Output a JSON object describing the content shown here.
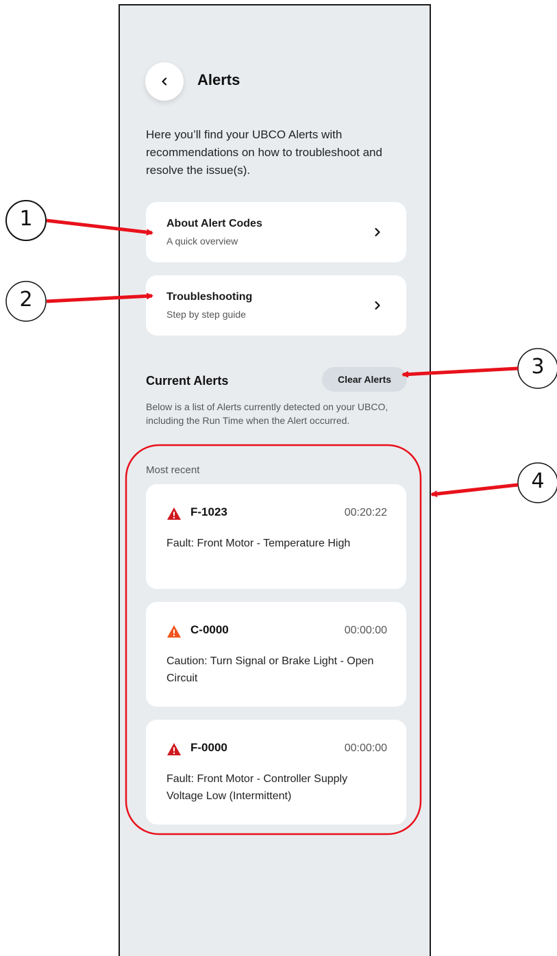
{
  "header": {
    "title": "Alerts"
  },
  "intro": "Here you’ll find your UBCO Alerts with recommendations on how to troubleshoot and resolve the issue(s).",
  "nav_cards": [
    {
      "title": "About Alert Codes",
      "subtitle": "A quick overview"
    },
    {
      "title": "Troubleshooting",
      "subtitle": "Step by step guide"
    }
  ],
  "current": {
    "title": "Current Alerts",
    "clear_label": "Clear Alerts",
    "description": "Below is a list of Alerts currently detected on your UBCO, including the Run Time when the Alert occurred.",
    "recent_label": "Most recent"
  },
  "alerts": [
    {
      "code": "F-1023",
      "time": "00:20:22",
      "description": "Fault: Front Motor - Temperature High",
      "severity": "fault",
      "icon_color": "#d0191f"
    },
    {
      "code": "C-0000",
      "time": "00:00:00",
      "description": "Caution: Turn Signal or Brake Light - Open Circuit",
      "severity": "caution",
      "icon_color": "#f2531c"
    },
    {
      "code": "F-0000",
      "time": "00:00:00",
      "description": "Fault: Front Motor - Controller Supply Voltage Low (Intermittent)",
      "severity": "fault",
      "icon_color": "#d0191f"
    }
  ],
  "annotations": {
    "labels": [
      "1",
      "2",
      "3",
      "4"
    ],
    "arrow_color": "#e8111b"
  }
}
